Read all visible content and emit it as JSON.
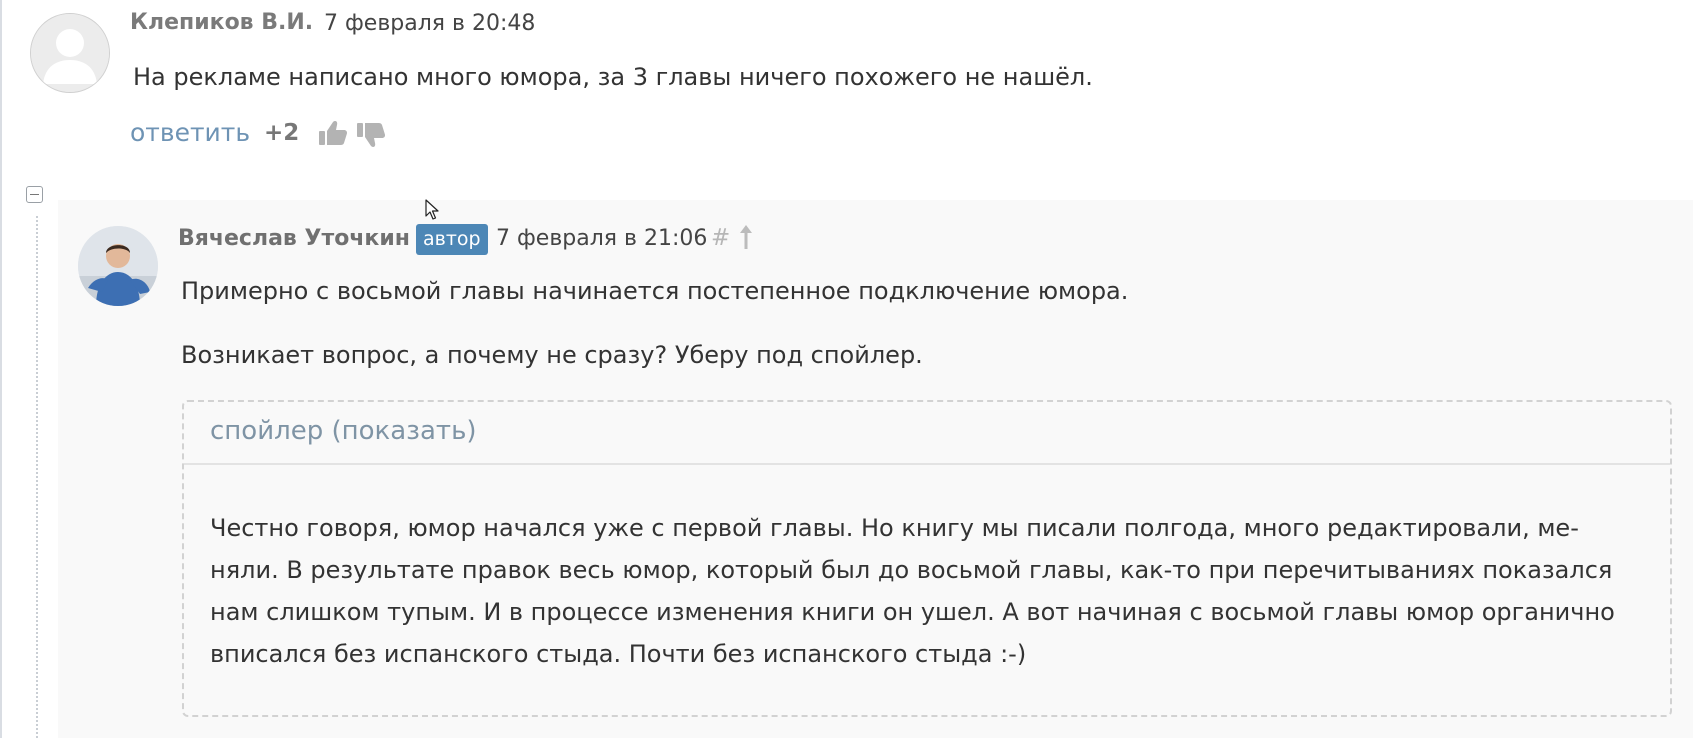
{
  "comment1": {
    "author": "Клепиков В.И.",
    "date": "7 февраля в 20:48",
    "text": "На рекламе написано много юмора, за 3 главы ничего похожего не нашёл.",
    "reply_label": "ответить",
    "score": "+2",
    "icons": [
      "avatar-placeholder-icon",
      "thumbs-up-icon",
      "thumbs-down-icon"
    ]
  },
  "reply": {
    "author": "Вячеслав Уточкин",
    "badge": "автор",
    "date": "7 февраля в 21:06",
    "hash": "#",
    "paragraph1": "Примерно с восьмой главы начинается постепенное подключение юмора.",
    "paragraph2": "Возникает вопрос, а почему не сразу? Уберу под спойлер.",
    "spoiler": {
      "title": "спойлер (показать)",
      "lines": [
        "Честно говоря, юмор начался уже с первой главы. Но книгу мы писали полгода, много редактировали, ме-",
        "няли. В результате правок весь юмор, который был до восьмой главы, как-то при перечитываниях показался",
        "нам слишком тупым. И в процессе изменения книги он ушел. А вот начиная с восьмой главы юмор органично",
        "вписался без испанского стыда. Почти без испанского стыда :-)"
      ]
    },
    "icons": [
      "up-arrow-icon",
      "collapse-icon"
    ]
  },
  "colors": {
    "link": "#6e93b4",
    "badge": "#4d87b6",
    "author": "#707070",
    "spoiler_title": "#7f94a5"
  }
}
